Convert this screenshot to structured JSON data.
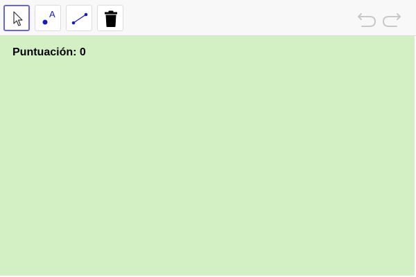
{
  "toolbar": {
    "tools": [
      {
        "name": "move",
        "icon": "cursor-arrow-icon",
        "selected": true
      },
      {
        "name": "point",
        "icon": "point-icon",
        "icon_letter": "A"
      },
      {
        "name": "segment",
        "icon": "segment-icon"
      },
      {
        "name": "delete",
        "icon": "trash-icon"
      }
    ],
    "undo_icon": "undo-icon",
    "redo_icon": "redo-icon"
  },
  "canvas": {
    "background": "#d2f0c3",
    "score_text": "Puntuación: 0"
  },
  "colors": {
    "selected_border": "#6a63e0",
    "icon_blue": "#1a1ab8",
    "history_disabled": "#c8c8c8"
  }
}
